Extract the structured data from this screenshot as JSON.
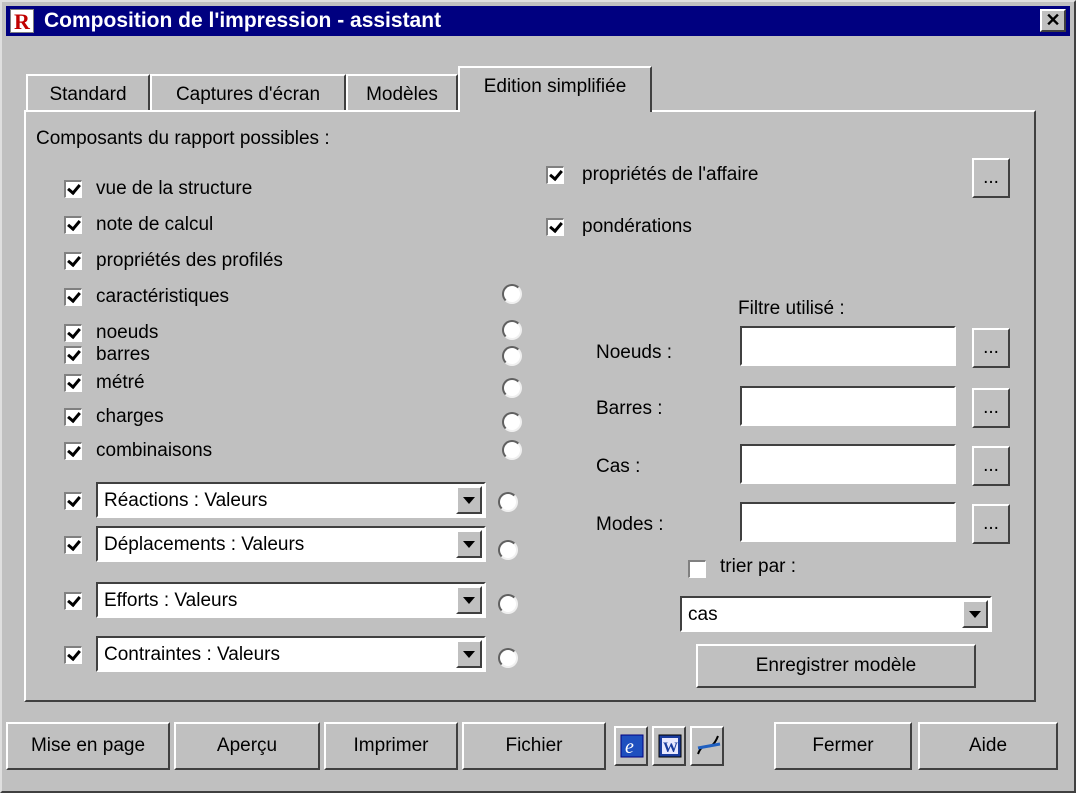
{
  "window": {
    "title": "Composition de l'impression - assistant",
    "close_glyph": "✕",
    "app_icon_letter": "R",
    "app_icon_color": "#c00000",
    "titlebar_color": "#000080"
  },
  "tabs": [
    {
      "label": "Standard",
      "active": false
    },
    {
      "label": "Captures d'écran",
      "active": false
    },
    {
      "label": "Modèles",
      "active": false
    },
    {
      "label": "Edition simplifiée",
      "active": true
    }
  ],
  "panel": {
    "heading": "Composants du rapport possibles :",
    "components": [
      {
        "label": "vue de la structure",
        "checked": true,
        "radio": false
      },
      {
        "label": "note de calcul",
        "checked": true,
        "radio": false
      },
      {
        "label": "propriétés des profilés",
        "checked": true,
        "radio": false
      },
      {
        "label": "caractéristiques",
        "checked": true,
        "radio": true
      },
      {
        "label": "noeuds",
        "checked": true,
        "radio": true
      },
      {
        "label": "barres",
        "checked": true,
        "radio": true
      },
      {
        "label": "métré",
        "checked": true,
        "radio": true
      },
      {
        "label": "charges",
        "checked": true,
        "radio": true
      },
      {
        "label": "combinaisons",
        "checked": true,
        "radio": true
      }
    ],
    "result_combos": [
      {
        "value": "Réactions : Valeurs",
        "checked": true
      },
      {
        "value": "Déplacements : Valeurs",
        "checked": true
      },
      {
        "value": "Efforts : Valeurs",
        "checked": true
      },
      {
        "value": "Contraintes : Valeurs",
        "checked": true
      }
    ],
    "right": {
      "affaire_label": "propriétés de l'affaire",
      "affaire_checked": true,
      "ponderations_label": "pondérations",
      "ponderations_checked": true,
      "dots_label": "...",
      "filter_heading": "Filtre utilisé :",
      "filters": [
        {
          "label": "Noeuds :",
          "value": ""
        },
        {
          "label": "Barres :",
          "value": ""
        },
        {
          "label": "Cas :",
          "value": ""
        },
        {
          "label": "Modes :",
          "value": ""
        }
      ],
      "sort_label": "trier par :",
      "sort_checked": false,
      "sort_value": "cas",
      "save_model_label": "Enregistrer modèle"
    }
  },
  "footer": {
    "mise_en_page": "Mise en page",
    "apercu": "Aperçu",
    "imprimer": "Imprimer",
    "fichier": "Fichier",
    "icons": [
      "internet-explorer-icon",
      "word-icon",
      "chart-icon"
    ],
    "fermer": "Fermer",
    "aide": "Aide"
  }
}
